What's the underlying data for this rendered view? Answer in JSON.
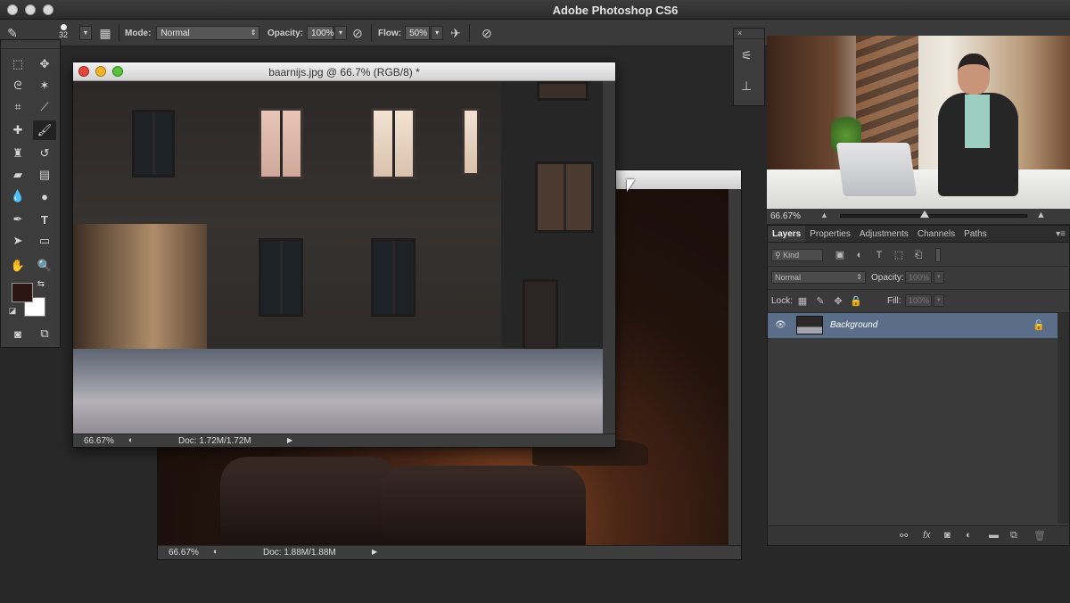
{
  "app": {
    "title": "Adobe Photoshop CS6"
  },
  "options_bar": {
    "brush_size": "32",
    "mode_label": "Mode:",
    "mode_value": "Normal",
    "opacity_label": "Opacity:",
    "opacity_value": "100%",
    "flow_label": "Flow:",
    "flow_value": "50%"
  },
  "tools": [
    "marquee-tool",
    "move-tool",
    "lasso-tool",
    "magic-wand-tool",
    "crop-tool",
    "eyedropper-tool",
    "healing-brush-tool",
    "brush-tool",
    "clone-stamp-tool",
    "history-brush-tool",
    "eraser-tool",
    "gradient-tool",
    "blur-tool",
    "dodge-tool",
    "pen-tool",
    "type-tool",
    "path-selection-tool",
    "rectangle-tool",
    "hand-tool",
    "zoom-tool"
  ],
  "colors": {
    "foreground": "#2c1512",
    "background": "#ffffff",
    "selected_layer": "#5a6d89"
  },
  "document_front": {
    "title": "baarnijs.jpg @ 66.7% (RGB/8) *",
    "zoom": "66.67%",
    "doc_size": "Doc: 1.72M/1.72M"
  },
  "document_back": {
    "zoom": "66.67%",
    "doc_size": "Doc: 1.88M/1.88M"
  },
  "navigator": {
    "zoom": "66.67%",
    "slider_position": 0.45
  },
  "layers_panel": {
    "tabs": [
      "Layers",
      "Properties",
      "Adjustments",
      "Channels",
      "Paths"
    ],
    "active_tab": "Layers",
    "filter_label": "Kind",
    "blend_mode": "Normal",
    "opacity_label": "Opacity:",
    "opacity_value": "100%",
    "lock_label": "Lock:",
    "fill_label": "Fill:",
    "fill_value": "100%",
    "layers": [
      {
        "name": "Background",
        "visible": true,
        "locked": true
      }
    ]
  }
}
